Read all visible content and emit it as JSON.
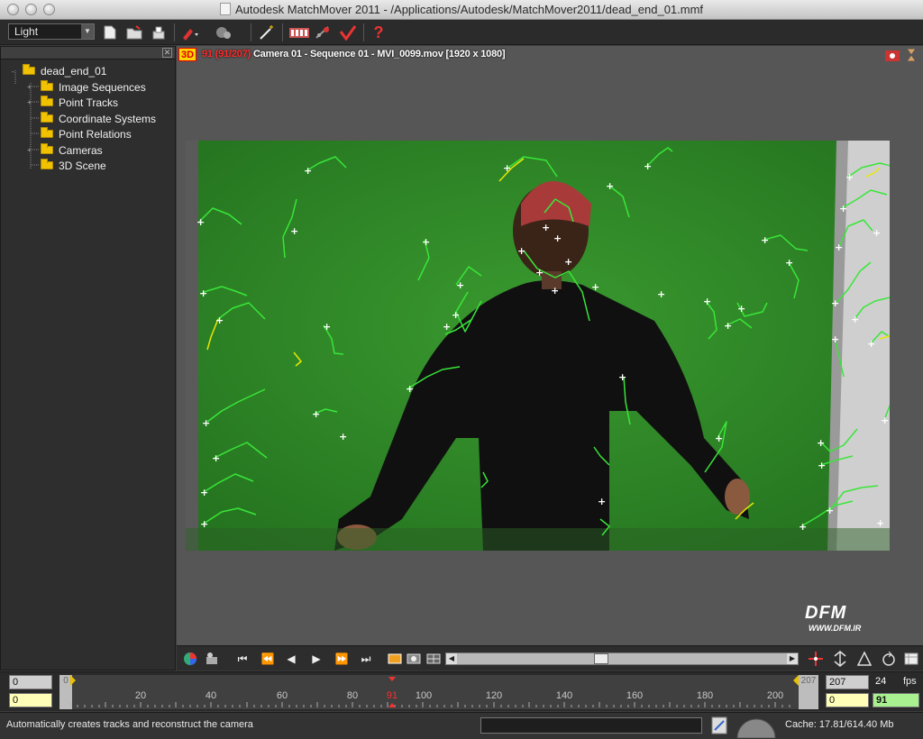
{
  "window": {
    "title": "Autodesk MatchMover 2011 - /Applications/Autodesk/MatchMover2011/dead_end_01.mmf"
  },
  "toolbar": {
    "layout_value": "Light",
    "icons": [
      "new-file-icon",
      "open-file-icon",
      "save-file-icon",
      "track-icon",
      "solver-icon",
      "magic-wand-icon",
      "film-strip-icon",
      "coordinate-icon",
      "export-icon",
      "help-icon"
    ]
  },
  "tree": {
    "root": "dead_end_01",
    "items": [
      {
        "label": "Image Sequences"
      },
      {
        "label": "Point Tracks"
      },
      {
        "label": "Coordinate Systems"
      },
      {
        "label": "Point Relations"
      },
      {
        "label": "Cameras"
      },
      {
        "label": "3D Scene"
      }
    ]
  },
  "viewer": {
    "mode_tag": "3D",
    "frame": "91",
    "frame_range": "(91/207)",
    "info": "Camera 01 - Sequence 01 - MVI_0099.mov [1920 x 1080]",
    "logo_big": "DFM",
    "logo_small": "WWW.DFM.IR"
  },
  "timeline": {
    "start_top": "0",
    "start_bottom": "0",
    "ruler_start": "0",
    "ruler_end": "207",
    "current_frame": "91",
    "ticks": [
      "20",
      "40",
      "60",
      "80",
      "100",
      "120",
      "140",
      "160",
      "180",
      "200"
    ],
    "end_top": "207",
    "end_bottom": "0",
    "fps_value": "24",
    "fps_label": "fps",
    "current_field": "91"
  },
  "status": {
    "message": "Automatically creates tracks and reconstruct the camera",
    "cache": "Cache: 17.81/614.40 Mb"
  },
  "colors": {
    "screen_green": "#2f8a2a",
    "track_green": "#39e639",
    "track_yellow": "#e8e800",
    "accent_red": "#ff2a2a"
  }
}
